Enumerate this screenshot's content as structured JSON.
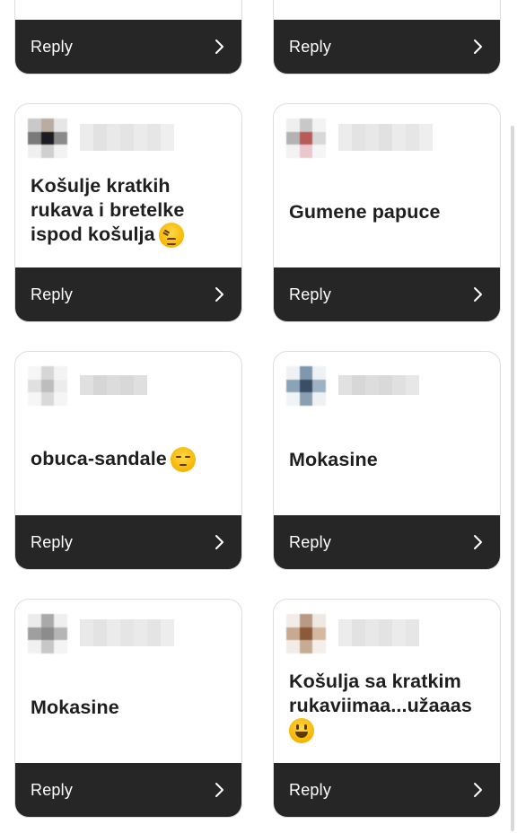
{
  "cards": [
    {
      "id": "c0",
      "text": "",
      "reply": "Reply"
    },
    {
      "id": "c1",
      "text": "",
      "reply": "Reply"
    },
    {
      "id": "c2",
      "text": "Košulje kratkih rukava i bretelke ispod košulja",
      "emoji": "confounded-face",
      "reply": "Reply"
    },
    {
      "id": "c3",
      "text": "Gumene papuce",
      "reply": "Reply"
    },
    {
      "id": "c4",
      "text": "obuca-sandale",
      "emoji": "unamused-face",
      "reply": "Reply"
    },
    {
      "id": "c5",
      "text": "Mokasine",
      "reply": "Reply"
    },
    {
      "id": "c6",
      "text": "Mokasine",
      "reply": "Reply"
    },
    {
      "id": "c7",
      "text": "Košulja sa kratkim rukaviimaa...užaaas",
      "emoji": "smiley-face",
      "reply": "Reply"
    }
  ],
  "icons": {
    "chevron": "chevron-right-icon"
  },
  "colors": {
    "reply_bar": "#262626",
    "card_border": "#dedede",
    "text": "#1e1e1e"
  }
}
